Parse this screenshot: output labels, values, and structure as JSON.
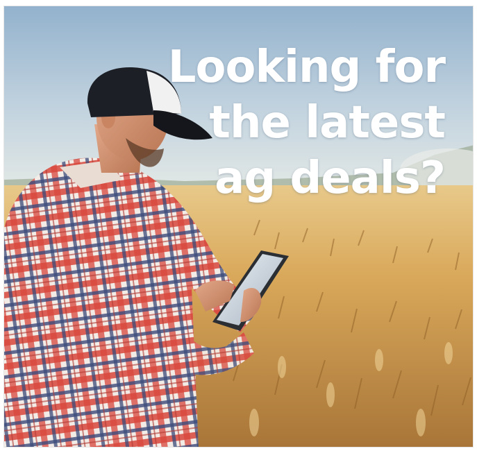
{
  "ad": {
    "headline": [
      "Looking for",
      "the latest",
      "ag deals?"
    ]
  },
  "colors": {
    "sky_top": "#a9c3db",
    "sky_bottom": "#dce6ea",
    "wheat_light": "#e3b86a",
    "wheat_dark": "#9a6a2c",
    "shirt_red": "#d9443a",
    "shirt_navy": "#3c4a78",
    "cap": "#1d1f26",
    "text": "#ffffff"
  },
  "icons": [
    "farmer-figure",
    "tablet-device",
    "wheat-field",
    "cap"
  ]
}
